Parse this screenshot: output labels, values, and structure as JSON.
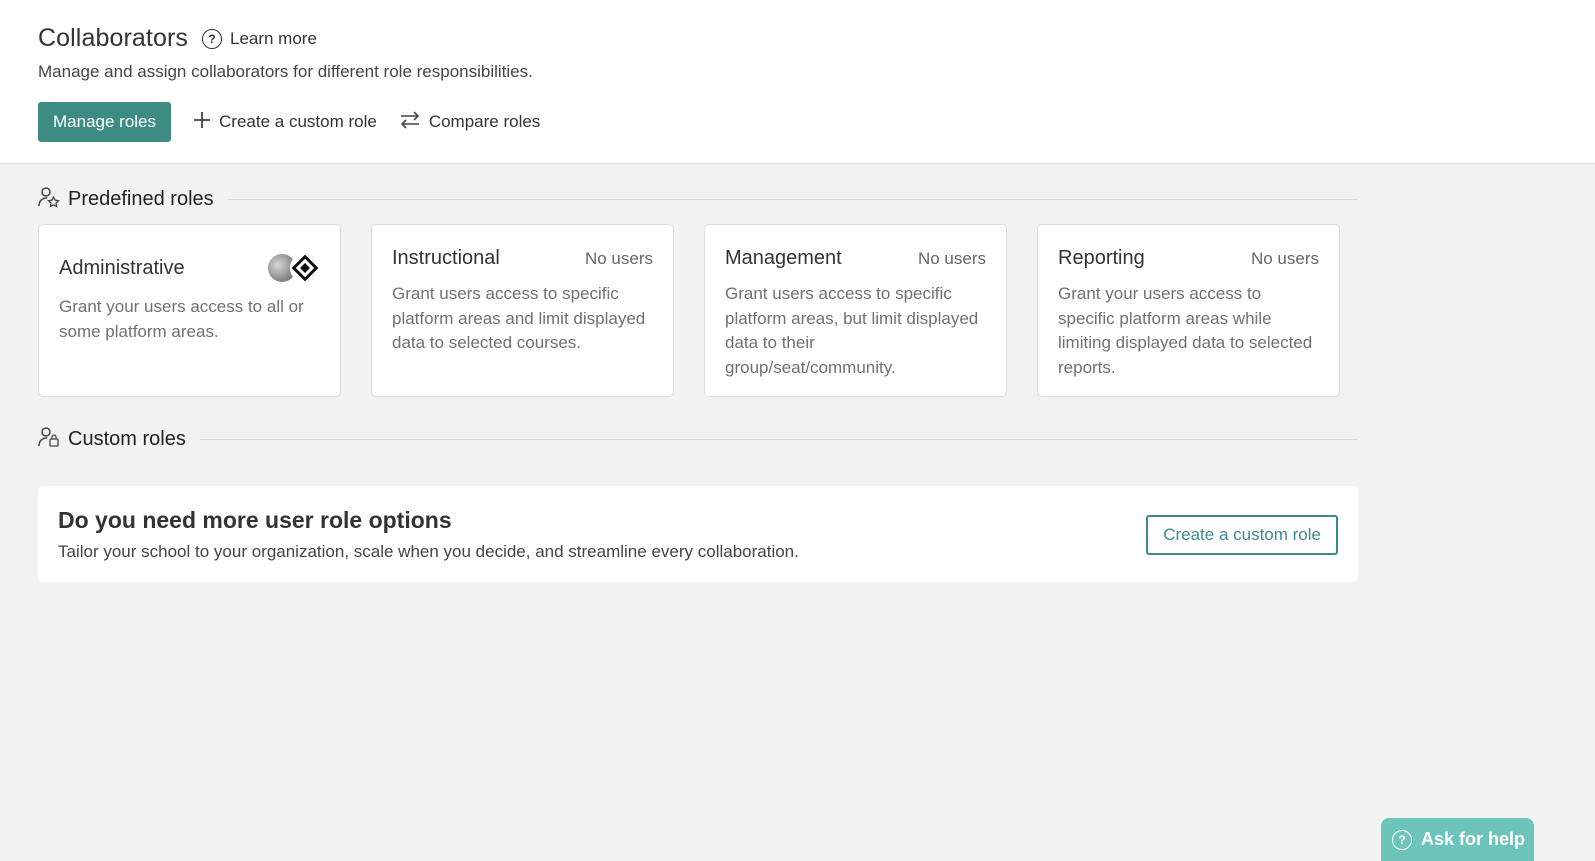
{
  "header": {
    "title": "Collaborators",
    "learn_more": "Learn more",
    "subtitle": "Manage and assign collaborators for different role responsibilities.",
    "actions": {
      "manage_roles": "Manage roles",
      "create_custom_role": "Create a custom role",
      "compare_roles": "Compare roles"
    }
  },
  "predefined": {
    "title": "Predefined roles",
    "cards": [
      {
        "name": "Administrative",
        "users": "",
        "description": "Grant your users access to all or some platform areas."
      },
      {
        "name": "Instructional",
        "users": "No users",
        "description": "Grant users access to specific platform areas and limit displayed data to selected courses."
      },
      {
        "name": "Management",
        "users": "No users",
        "description": "Grant users access to specific platform areas, but limit displayed data to their group/seat/community."
      },
      {
        "name": "Reporting",
        "users": "No users",
        "description": "Grant your users access to specific platform areas while limiting displayed data to selected reports."
      }
    ]
  },
  "custom": {
    "title": "Custom roles",
    "promo_title": "Do you need more user role options",
    "promo_description": "Tailor your school to your organization, scale when you decide, and streamline every collaboration.",
    "promo_button": "Create a custom role"
  },
  "help": {
    "label": "Ask for help"
  },
  "colors": {
    "accent": "#3d8c84",
    "help_bg": "#6cc4bb",
    "page_bg": "#f2f2f2"
  }
}
